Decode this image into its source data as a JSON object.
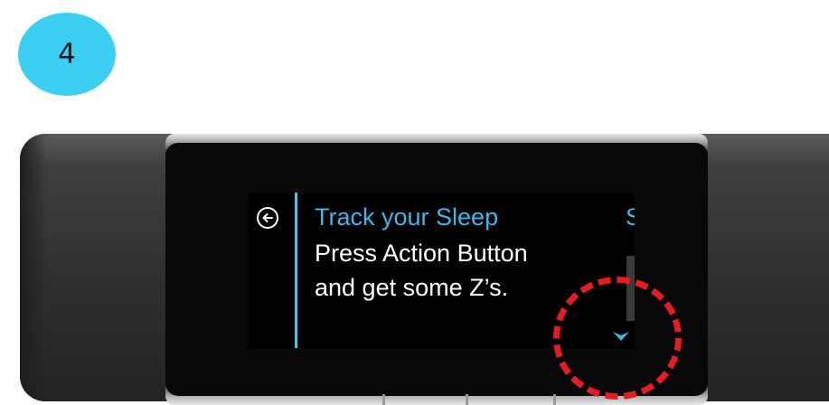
{
  "step": {
    "number": "4"
  },
  "device": {
    "screen": {
      "title": "Track your Sleep",
      "line1": "Press Action Button",
      "line2": "and get some Z’s.",
      "next_tile_peek": "S"
    },
    "icons": {
      "back": "back-arrow-circle-icon",
      "scroll": "chevron-down-icon"
    }
  },
  "colors": {
    "badge": "#3dcff2",
    "accent": "#3fb6ea",
    "highlight": "#e31d22"
  }
}
